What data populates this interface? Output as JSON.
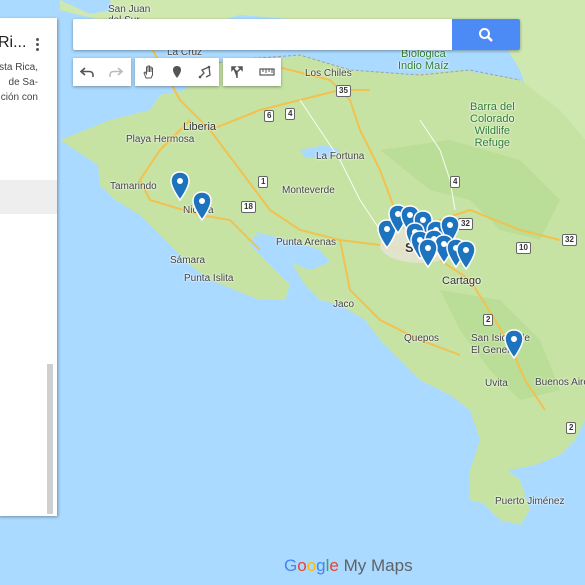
{
  "panel": {
    "title": "Ri...",
    "desc_lines": [
      "sta Rica,",
      "de Sa-",
      "ción con"
    ]
  },
  "search": {
    "placeholder": "",
    "value": ""
  },
  "toolbar": {
    "undo": "undo-icon",
    "redo": "redo-icon",
    "hand": "hand-icon",
    "marker": "marker-icon",
    "line": "draw-line-icon",
    "route": "directions-icon",
    "measure": "ruler-icon"
  },
  "footer": {
    "google": "Google",
    "mymaps": "My Maps"
  },
  "colors": {
    "land": "#c9e6a8",
    "water": "#aadaff",
    "pin": "#1e73be",
    "search_button": "#4c8bf5"
  },
  "map_labels": {
    "san_juan": "San Juan\ndel Sur",
    "la_cruz": "La Cruz",
    "los_chiles": "Los Chiles",
    "biologica": "Biológica\nIndio Maíz",
    "barra": "Barra del\nColorado\nWildlife\nRefuge",
    "liberia": "Liberia",
    "playa_hermosa": "Playa Hermosa",
    "la_fortuna": "La Fortuna",
    "tamarindo": "Tamarindo",
    "nicoya": "Nicoya",
    "monteverde": "Monteverde",
    "puntarenas": "Punta Arenas",
    "samara": "Sámara",
    "punta_islita": "Punta Islita",
    "san_jose": "San José",
    "cartago": "Cartago",
    "jaco": "Jaco",
    "quepos": "Quepos",
    "san_isidro": "San Isidro de\nEl General",
    "uvita": "Uvita",
    "buenos_aires": "Buenos Aire",
    "puerto_jimenez": "Puerto Jiménez"
  },
  "shields": [
    "35",
    "6",
    "4",
    "1",
    "18",
    "4",
    "32",
    "10",
    "2",
    "2",
    "32"
  ]
}
